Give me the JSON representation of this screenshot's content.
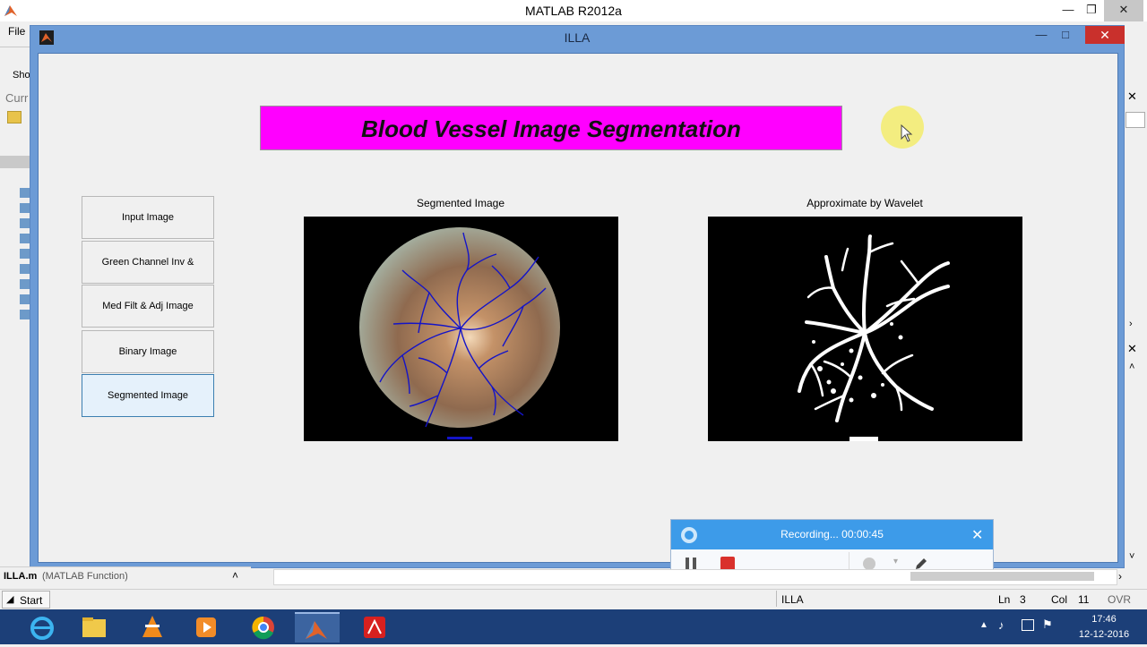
{
  "matlab_window": {
    "title": "MATLAB  R2012a",
    "menu_file": "File",
    "shortcuts_fragment": "Sho",
    "current_folder_fragment": "Curr",
    "controls": {
      "minimize": "—",
      "maximize": "❐",
      "close": "✕"
    }
  },
  "figure": {
    "title": "ILLA",
    "controls": {
      "minimize": "—",
      "maximize": "□",
      "close": "✕"
    },
    "banner_title": "Blood Vessel Image Segmentation",
    "buttons": [
      {
        "label": "Input Image",
        "active": false
      },
      {
        "label": "Green Channel Inv & Enhance",
        "active": false
      },
      {
        "label": "Med Filt & Adj Image",
        "active": false
      },
      {
        "label": "Binary Image",
        "active": false
      },
      {
        "label": "Segmented Image",
        "active": true
      }
    ],
    "left_axes_title": "Segmented Image",
    "right_axes_title": "Approximate by Wavelet"
  },
  "recorder": {
    "status": "Recording... 00:00:45",
    "icons": [
      "camera-icon",
      "pause-icon",
      "stop-icon",
      "webcam-icon",
      "pen-icon",
      "close-icon"
    ]
  },
  "editor_status": {
    "file_label": "ILLA.m",
    "file_type": "(MATLAB Function)",
    "start_label": "Start",
    "function_name": "ILLA",
    "ln_label": "Ln",
    "ln_value": "3",
    "col_label": "Col",
    "col_value": "11",
    "ovr": "OVR"
  },
  "taskbar": {
    "apps": [
      "internet-explorer-icon",
      "file-explorer-icon",
      "vlc-icon",
      "media-player-icon",
      "chrome-icon",
      "matlab-icon",
      "acrobat-icon"
    ],
    "time": "17:46",
    "date": "12-12-2016"
  },
  "colors": {
    "banner": "#ff00ff",
    "figure_frame": "#6c9bd6",
    "recorder_head": "#3d9be9",
    "taskbar": "#1c3f78",
    "vessel_overlay": "#1414c8"
  }
}
